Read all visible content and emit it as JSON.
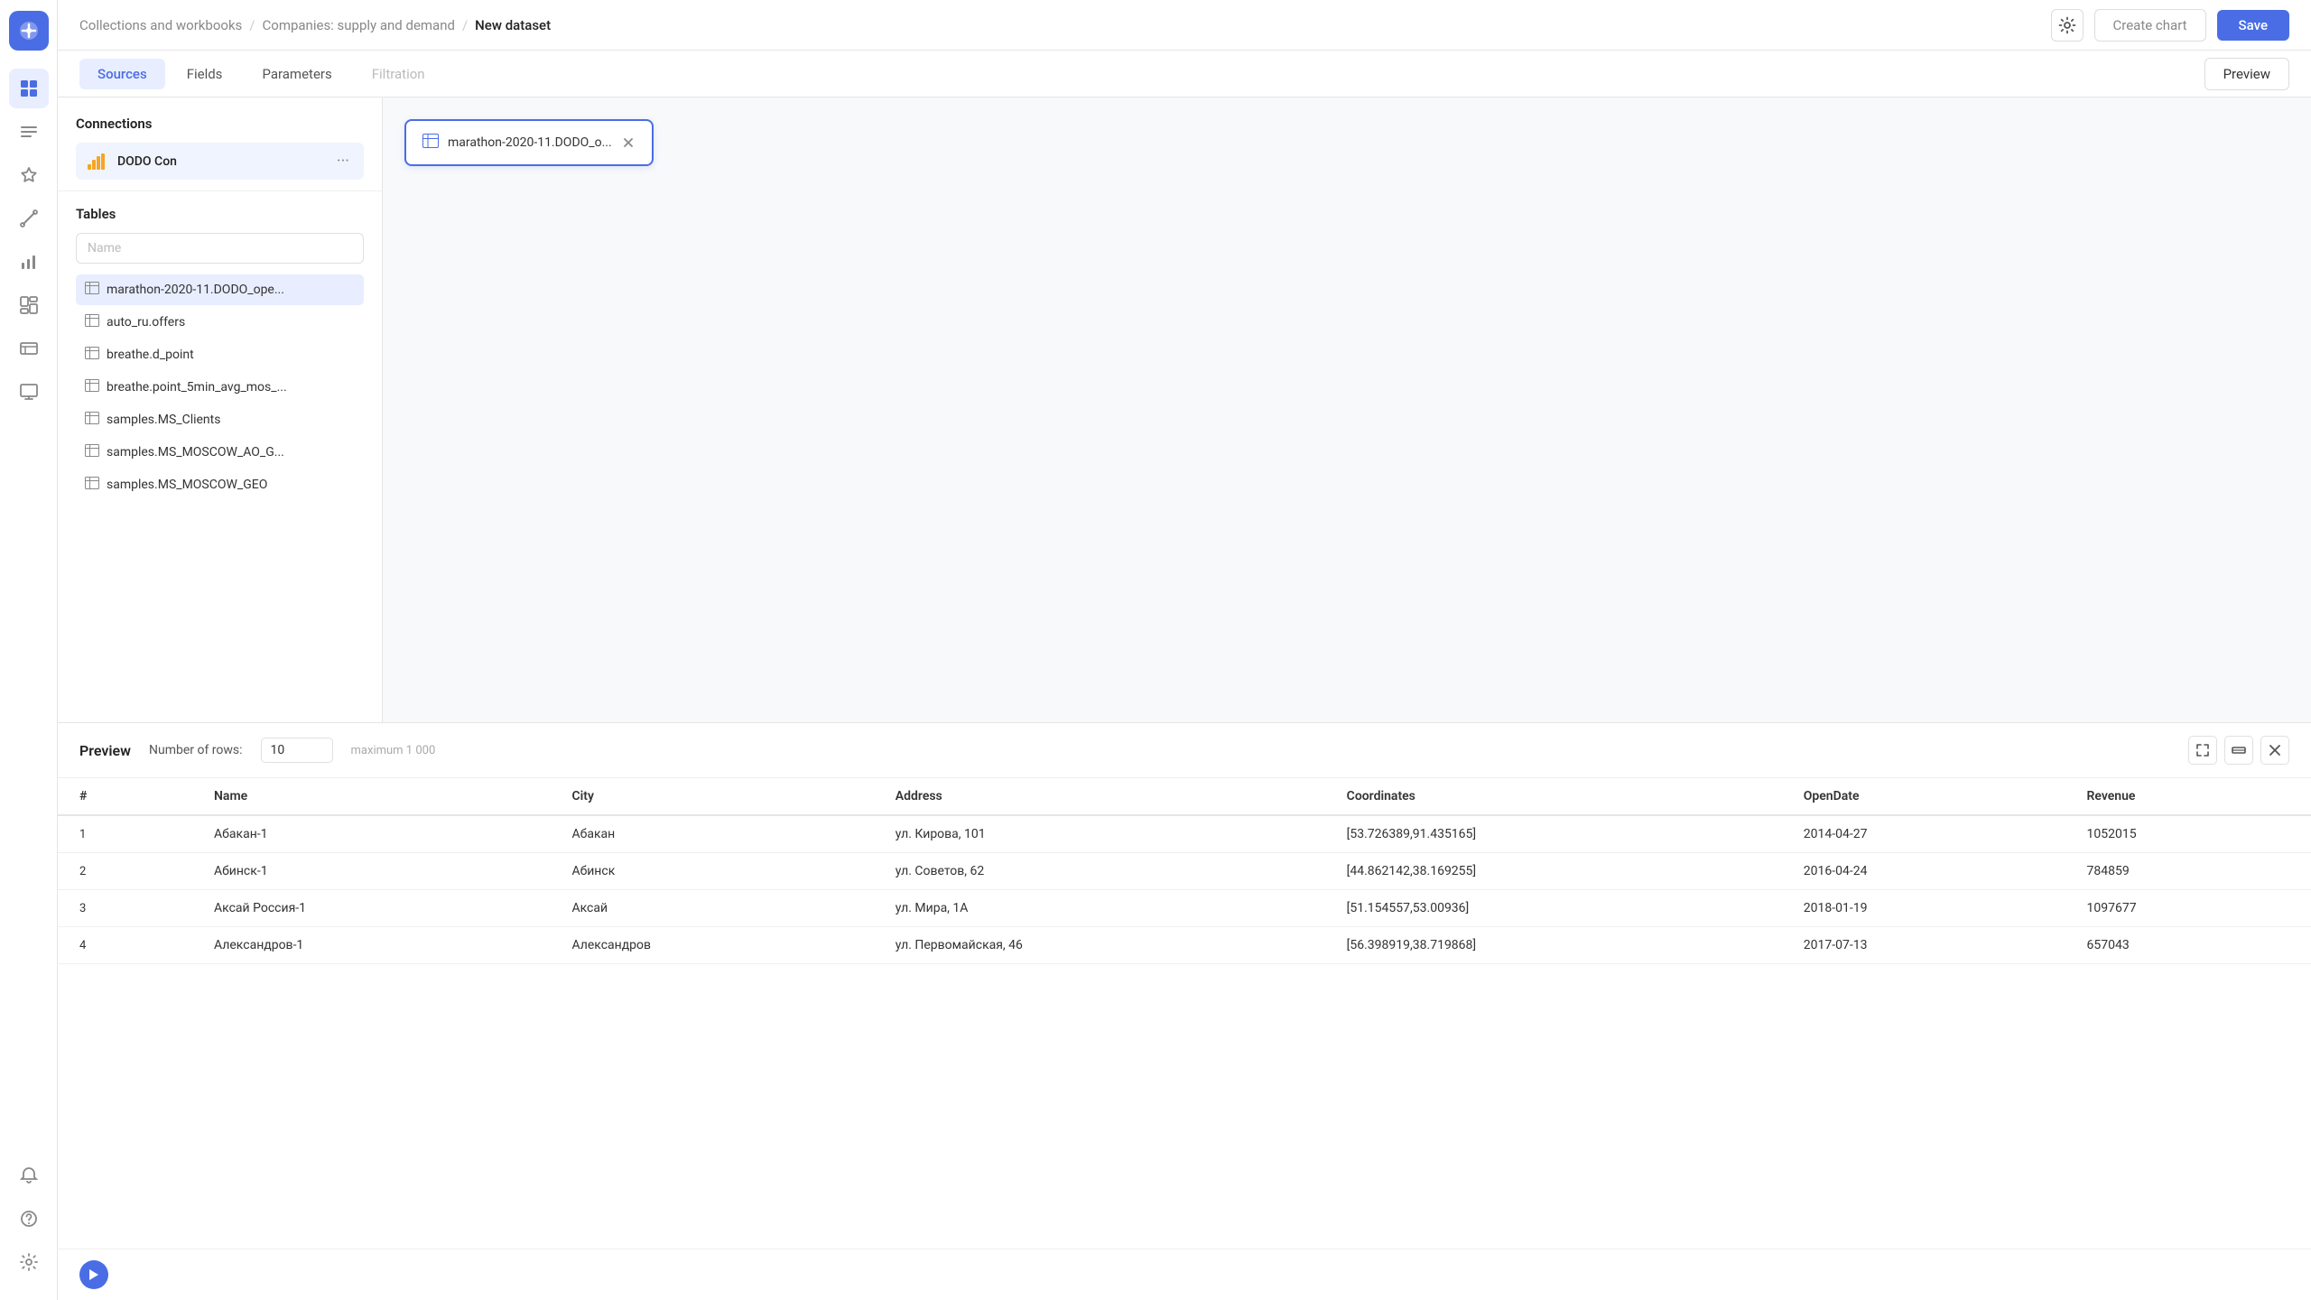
{
  "app": {
    "logo_bg": "#4a6de5"
  },
  "header": {
    "breadcrumb": {
      "part1": "Collections and workbooks",
      "sep1": "/",
      "part2": "Companies: supply and demand",
      "sep2": "/",
      "current": "New dataset"
    },
    "gear_label": "⚙",
    "create_chart_label": "Create chart",
    "save_label": "Save"
  },
  "tabs": {
    "items": [
      {
        "id": "sources",
        "label": "Sources",
        "active": true,
        "disabled": false
      },
      {
        "id": "fields",
        "label": "Fields",
        "active": false,
        "disabled": false
      },
      {
        "id": "parameters",
        "label": "Parameters",
        "active": false,
        "disabled": false
      },
      {
        "id": "filtration",
        "label": "Filtration",
        "active": false,
        "disabled": true
      }
    ],
    "preview_label": "Preview"
  },
  "connections": {
    "section_title": "Connections",
    "items": [
      {
        "id": "dodo",
        "name": "DODO Con"
      }
    ]
  },
  "tables": {
    "section_title": "Tables",
    "search_placeholder": "Name",
    "items": [
      {
        "id": 1,
        "name": "marathon-2020-11.DODO_ope...",
        "selected": true
      },
      {
        "id": 2,
        "name": "auto_ru.offers",
        "selected": false
      },
      {
        "id": 3,
        "name": "breathe.d_point",
        "selected": false
      },
      {
        "id": 4,
        "name": "breathe.point_5min_avg_mos_...",
        "selected": false
      },
      {
        "id": 5,
        "name": "samples.MS_Clients",
        "selected": false
      },
      {
        "id": 6,
        "name": "samples.MS_MOSCOW_AO_G...",
        "selected": false
      },
      {
        "id": 7,
        "name": "samples.MS_MOSCOW_GEO",
        "selected": false
      }
    ]
  },
  "canvas": {
    "node_label": "marathon-2020-11.DODO_o..."
  },
  "preview": {
    "title": "Preview",
    "rows_label": "Number of rows:",
    "rows_value": "10",
    "rows_max": "maximum 1 000",
    "columns": [
      {
        "id": "num",
        "label": "#"
      },
      {
        "id": "name",
        "label": "Name"
      },
      {
        "id": "city",
        "label": "City"
      },
      {
        "id": "address",
        "label": "Address"
      },
      {
        "id": "coordinates",
        "label": "Coordinates"
      },
      {
        "id": "opendate",
        "label": "OpenDate"
      },
      {
        "id": "revenue",
        "label": "Revenue"
      }
    ],
    "rows": [
      {
        "num": "1",
        "name": "Абакан-1",
        "city": "Абакан",
        "address": "ул. Кирова, 101",
        "coordinates": "[53.726389,91.435165]",
        "opendate": "2014-04-27",
        "revenue": "1052015"
      },
      {
        "num": "2",
        "name": "Абинск-1",
        "city": "Абинск",
        "address": "ул. Советов, 62",
        "coordinates": "[44.862142,38.169255]",
        "opendate": "2016-04-24",
        "revenue": "784859"
      },
      {
        "num": "3",
        "name": "Аксай Россия-1",
        "city": "Аксай",
        "address": "ул. Мира, 1А",
        "coordinates": "[51.154557,53.00936]",
        "opendate": "2018-01-19",
        "revenue": "1097677"
      },
      {
        "num": "4",
        "name": "Александров-1",
        "city": "Александров",
        "address": "ул. Первомайская, 46",
        "coordinates": "[56.398919,38.719868]",
        "opendate": "2017-07-13",
        "revenue": "657043"
      }
    ]
  },
  "sidebar_icons": [
    {
      "id": "apps",
      "icon": "⊞",
      "active": false
    },
    {
      "id": "collections",
      "icon": "☰",
      "active": false
    },
    {
      "id": "charts",
      "icon": "★",
      "active": false
    },
    {
      "id": "lightning",
      "icon": "⚡",
      "active": false
    },
    {
      "id": "connections-icon",
      "icon": "◎",
      "active": false
    },
    {
      "id": "bar-chart",
      "icon": "▦",
      "active": false
    },
    {
      "id": "grid",
      "icon": "⊡",
      "active": false
    },
    {
      "id": "monitor",
      "icon": "▭",
      "active": false
    },
    {
      "id": "user",
      "icon": "👤",
      "active": false
    }
  ],
  "sidebar_bottom": [
    {
      "id": "bell",
      "icon": "🔔"
    },
    {
      "id": "help",
      "icon": "?"
    },
    {
      "id": "settings",
      "icon": "⚙"
    }
  ]
}
